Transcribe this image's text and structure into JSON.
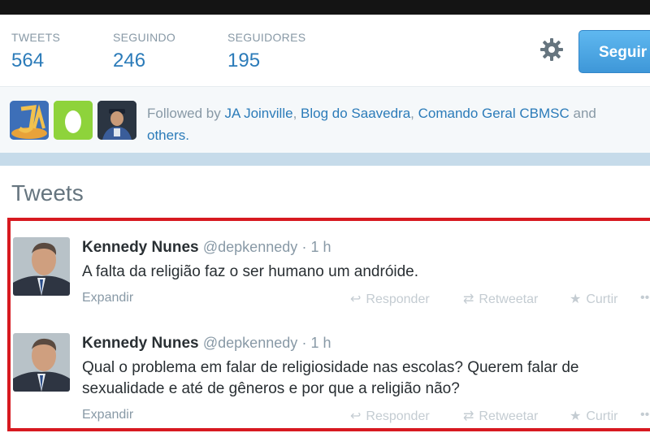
{
  "stats": [
    {
      "label": "TWEETS",
      "value": "564"
    },
    {
      "label": "SEGUINDO",
      "value": "246"
    },
    {
      "label": "SEGUIDORES",
      "value": "195"
    }
  ],
  "follow_button": "Seguir",
  "followed_by": {
    "prefix": "Followed by",
    "names": [
      "JA Joinville",
      "Blog do Saavedra",
      "Comando Geral CBMSC"
    ],
    "and": "and",
    "others": "others."
  },
  "tweets_title": "Tweets",
  "tweets": [
    {
      "name": "Kennedy Nunes",
      "handle": "@depkennedy",
      "time": "· 1 h",
      "text": "A falta da religião faz o ser humano um andróide.",
      "expand": "Expandir",
      "reply": "Responder",
      "retweet": "Retweetar",
      "favorite": "Curtir"
    },
    {
      "name": "Kennedy Nunes",
      "handle": "@depkennedy",
      "time": "· 1 h",
      "text": "Qual o problema em falar de religiosidade nas escolas? Querem falar de sexualidade e até de gêneros e por que a religião não?",
      "expand": "Expandir",
      "reply": "Responder",
      "retweet": "Retweetar",
      "favorite": "Curtir"
    }
  ],
  "colors": {
    "link": "#2b7bb9",
    "highlight_border": "#d71920",
    "follow_button": "#3e97d8"
  },
  "icons": {
    "settings": "gear-icon",
    "reply": "reply-icon",
    "retweet": "retweet-icon",
    "favorite": "star-icon",
    "more": "more-icon"
  }
}
